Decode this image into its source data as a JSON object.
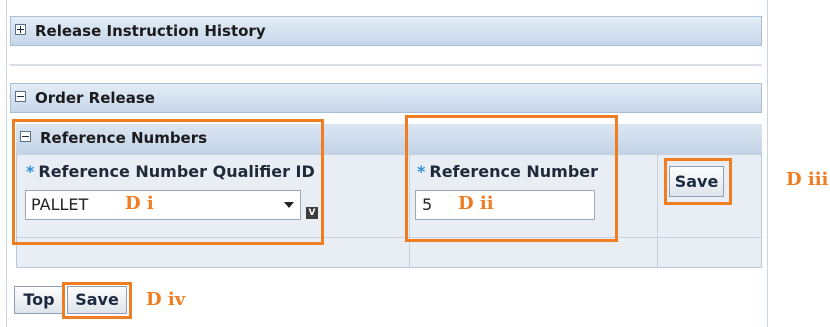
{
  "sections": {
    "release_history": {
      "title": "Release Instruction History"
    },
    "order_release": {
      "title": "Order Release"
    },
    "reference_numbers": {
      "title": "Reference Numbers"
    }
  },
  "form": {
    "qualifier_label": "Reference Number Qualifier ID",
    "qualifier_value": "PALLET",
    "qualifier_lookup": "V",
    "number_label": "Reference Number",
    "number_value": "5",
    "required_marker": "*",
    "row_save_label": "Save"
  },
  "footer": {
    "top_label": "Top",
    "save_label": "Save"
  },
  "annotations": {
    "d_i": "D i",
    "d_ii": "D ii",
    "d_iii": "D iii",
    "d_iv": "D iv"
  },
  "colors": {
    "annotation": "#f07d22",
    "header": "#c6d6ea",
    "required": "#2f8fd8"
  }
}
